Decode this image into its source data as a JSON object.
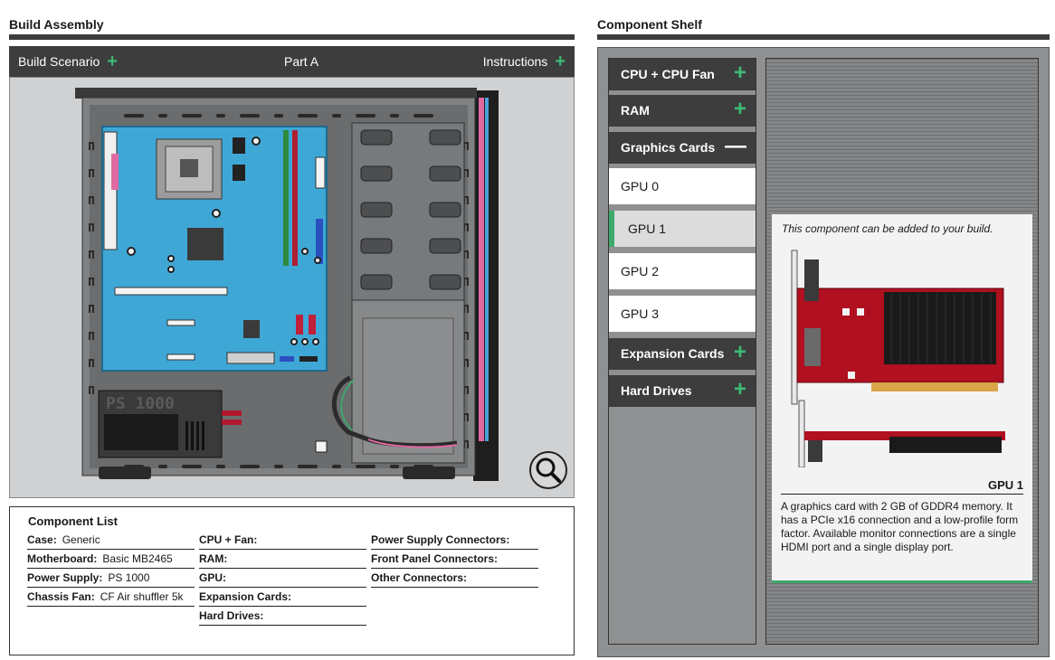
{
  "build_assembly": {
    "title": "Build Assembly",
    "toolbar": {
      "scenario_label": "Build Scenario",
      "part_label": "Part A",
      "instructions_label": "Instructions"
    },
    "psu_label": "PS 1000",
    "zoom_icon": "magnifier-icon"
  },
  "component_list": {
    "heading": "Component List",
    "col1": [
      {
        "label": "Case:",
        "value": "Generic"
      },
      {
        "label": "Motherboard:",
        "value": "Basic MB2465"
      },
      {
        "label": "Power Supply:",
        "value": "PS 1000"
      },
      {
        "label": "Chassis Fan:",
        "value": "CF Air shuffler 5k"
      }
    ],
    "col2": [
      {
        "label": "CPU + Fan:",
        "value": ""
      },
      {
        "label": "RAM:",
        "value": ""
      },
      {
        "label": "GPU:",
        "value": ""
      },
      {
        "label": "Expansion Cards:",
        "value": ""
      },
      {
        "label": "Hard Drives:",
        "value": ""
      }
    ],
    "col3": [
      {
        "label": "Power Supply Connectors:",
        "value": ""
      },
      {
        "label": "Front Panel Connectors:",
        "value": ""
      },
      {
        "label": "Other Connectors:",
        "value": ""
      }
    ]
  },
  "component_shelf": {
    "title": "Component Shelf",
    "categories": {
      "cpu": {
        "label": "CPU + CPU Fan",
        "toggle": "+"
      },
      "ram": {
        "label": "RAM",
        "toggle": "+"
      },
      "graphics": {
        "label": "Graphics Cards",
        "toggle": "—"
      },
      "expansion": {
        "label": "Expansion Cards",
        "toggle": "+"
      },
      "hdd": {
        "label": "Hard Drives",
        "toggle": "+"
      }
    },
    "gpus": [
      "GPU 0",
      "GPU 1",
      "GPU 2",
      "GPU 3"
    ],
    "selected_gpu": "GPU 1",
    "detail": {
      "note": "This component can be added to your build.",
      "name": "GPU 1",
      "description": "A graphics card with 2 GB of GDDR4 memory. It has a PCIe x16 connection and a low-profile form factor. Available monitor connections are a single HDMI port and a single display port."
    }
  },
  "colors": {
    "accent_green": "#3dbb73",
    "toolbar_dark": "#3d3d3d",
    "motherboard_blue": "#3fa7d6",
    "gpu_red": "#b01020"
  }
}
